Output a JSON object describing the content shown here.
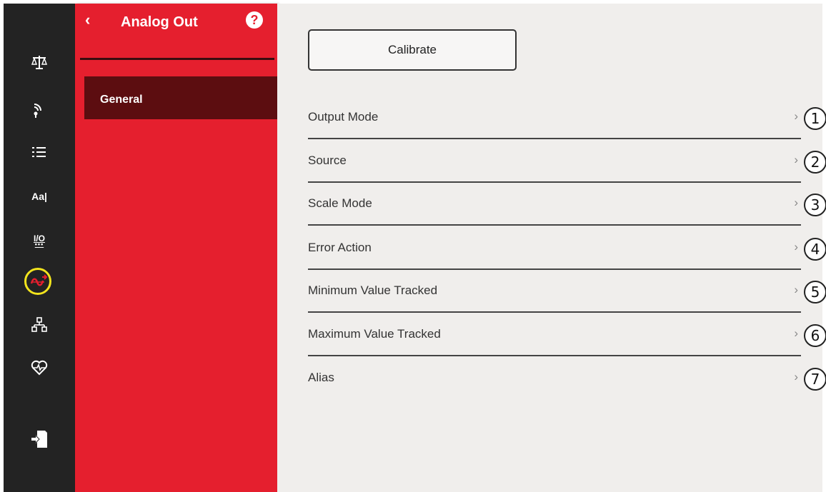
{
  "rail": {
    "icons": [
      {
        "name": "scale-icon"
      },
      {
        "name": "wireless-signal-icon"
      },
      {
        "name": "list-icon"
      },
      {
        "name": "font-format-icon",
        "text": "Aa|"
      },
      {
        "name": "io-icon",
        "text": "I/O",
        "dots": "•••"
      },
      {
        "name": "analog-output-icon",
        "highlighted": true,
        "highlight_color": "#f2e41d"
      },
      {
        "name": "network-icon"
      },
      {
        "name": "heart-health-icon"
      },
      {
        "name": "logout-icon"
      }
    ]
  },
  "menu": {
    "back_glyph": "‹",
    "title": "Analog Out",
    "help_glyph": "?",
    "items": [
      {
        "label": "General",
        "selected": true
      }
    ]
  },
  "main": {
    "calibrate_label": "Calibrate",
    "chevron_glyph": "›",
    "rows": [
      {
        "label": "Output Mode",
        "callout": "1"
      },
      {
        "label": "Source",
        "callout": "2"
      },
      {
        "label": "Scale Mode",
        "callout": "3"
      },
      {
        "label": "Error Action",
        "callout": "4"
      },
      {
        "label": "Minimum Value Tracked",
        "callout": "5"
      },
      {
        "label": "Maximum Value Tracked",
        "callout": "6"
      },
      {
        "label": "Alias",
        "callout": "7"
      }
    ]
  },
  "colors": {
    "rail_bg": "#232323",
    "menu_bg": "#e51f2e",
    "menu_selected_bg": "#5c0d10",
    "main_bg": "#f0eeec",
    "highlight": "#f2e41d"
  }
}
